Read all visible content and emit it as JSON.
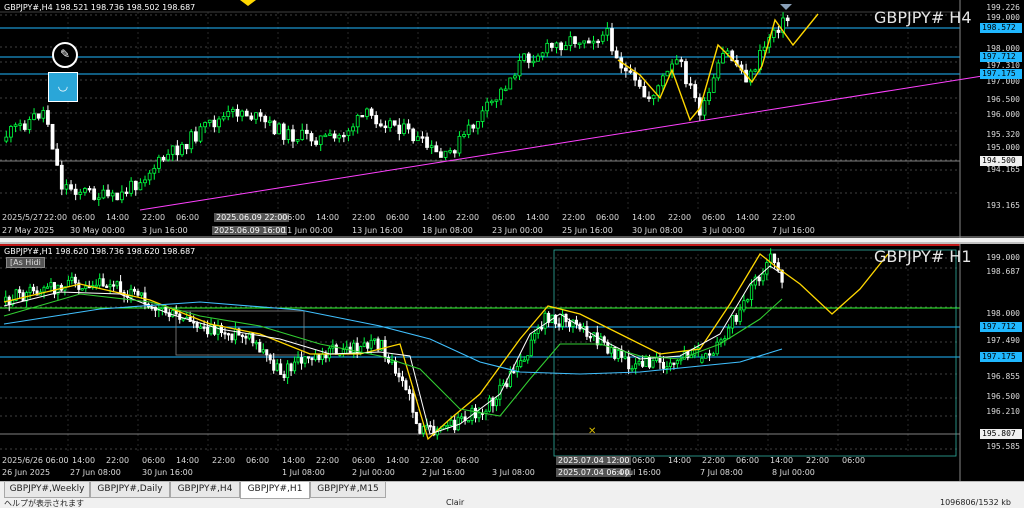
{
  "top_chart": {
    "header": "GBPJPY#,H4  198.521 198.736 198.502 198.687",
    "title": "GBPJPY# H4",
    "price_labels": [
      "199.226",
      "199.000",
      "198.000",
      "197.310",
      "197.000",
      "196.500",
      "196.000",
      "195.320",
      "195.000",
      "194.165",
      "193.165"
    ],
    "price_tags": [
      {
        "text": "198.572",
        "color": "#20b8ff"
      },
      {
        "text": "197.712",
        "color": "#20b8ff"
      },
      {
        "text": "197.175",
        "color": "#20b8ff"
      },
      {
        "text": "194.500",
        "color": "#f0f0f0"
      }
    ],
    "time_labels": [
      "2025/5/27",
      "22:00",
      "06:00",
      "14:00",
      "22:00",
      "06:00",
      "2025.06.09 22:00",
      "06:00",
      "14:00",
      "22:00",
      "06:00",
      "14:00",
      "22:00",
      "06:00",
      "14:00",
      "22:00",
      "06:00",
      "14:00",
      "22:00",
      "06:00",
      "14:00",
      "22:00"
    ],
    "date_labels": [
      "27 May 2025",
      "30 May 00:00",
      "3 Jun 16:00",
      "2025.06.09 16:00",
      "11 Jun 00:00",
      "13 Jun 16:00",
      "18 Jun 08:00",
      "23 Jun 00:00",
      "25 Jun 16:00",
      "30 Jun 08:00",
      "3 Jul 00:00",
      "7 Jul 16:00"
    ]
  },
  "bottom_chart": {
    "header": "GBPJPY#,H1  198.620 198.736 198.620 198.687",
    "title": "GBPJPY# H1",
    "as_hidden_label": "[As Hidi",
    "price_labels": [
      "199.000",
      "198.687",
      "198.000",
      "197.490",
      "196.855",
      "196.500",
      "196.210",
      "195.585"
    ],
    "price_tags": [
      {
        "text": "197.712",
        "color": "#20b8ff"
      },
      {
        "text": "197.175",
        "color": "#20b8ff"
      },
      {
        "text": "195.807",
        "color": "#f0f0f0"
      }
    ],
    "time_labels": [
      "2025/6/26 06:00",
      "14:00",
      "22:00",
      "06:00",
      "14:00",
      "22:00",
      "06:00",
      "14:00",
      "22:00",
      "06:00",
      "14:00",
      "22:00",
      "06:00",
      "2025.07.04 12:00",
      "06:00",
      "14:00",
      "22:00",
      "06:00",
      "14:00",
      "22:00",
      "06:00"
    ],
    "date_labels": [
      "26 Jun 2025",
      "27 Jun 08:00",
      "30 Jun 16:00",
      "1 Jul 08:00",
      "2 Jul 00:00",
      "2 Jul 16:00",
      "3 Jul 08:00",
      "2025.07.04 06:00",
      "4 Jul 16:00",
      "7 Jul 08:00",
      "8 Jul 00:00"
    ]
  },
  "tabs": [
    "GBPJPY#,Weekly",
    "GBPJPY#,Daily",
    "GBPJPY#,H4",
    "GBPJPY#,H1",
    "GBPJPY#,M15"
  ],
  "active_tab": "GBPJPY#,H1",
  "status": {
    "left": "ヘルプが表示されます",
    "middle": "Clair",
    "right": "1096806/1532 kb"
  },
  "colors": {
    "up_candle": "#00ff40",
    "down_candle": "#ffffff",
    "forecast": "#ffd700",
    "trendline": "#ff40ff",
    "ma_fast": "#ffffff",
    "ma_mid": "#32cd32",
    "ma_slow": "#40c0ff",
    "level": "#20b8ff"
  }
}
